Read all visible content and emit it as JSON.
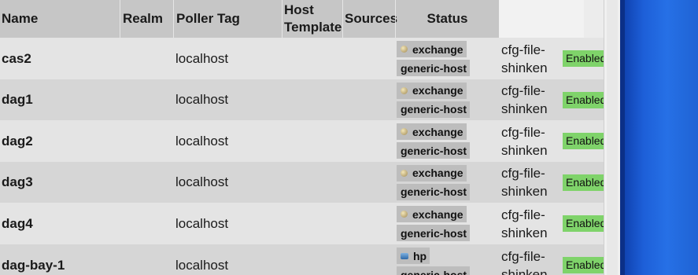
{
  "columns": {
    "name": "Name",
    "realm": "Realm",
    "poller_tag": "Poller Tag",
    "host_template": "Host Template",
    "sources": "Sources",
    "status": "Status"
  },
  "rows": [
    {
      "name": "cas2",
      "poller": "localhost",
      "tag1": "exchange",
      "tag1_icon": "exchange-icon",
      "tag2": "generic-host",
      "source_line1": "cfg-file-",
      "source_line2": "shinken",
      "status": "Enabled"
    },
    {
      "name": "dag1",
      "poller": "localhost",
      "tag1": "exchange",
      "tag1_icon": "exchange-icon",
      "tag2": "generic-host",
      "source_line1": "cfg-file-",
      "source_line2": "shinken",
      "status": "Enabled"
    },
    {
      "name": "dag2",
      "poller": "localhost",
      "tag1": "exchange",
      "tag1_icon": "exchange-icon",
      "tag2": "generic-host",
      "source_line1": "cfg-file-",
      "source_line2": "shinken",
      "status": "Enabled"
    },
    {
      "name": "dag3",
      "poller": "localhost",
      "tag1": "exchange",
      "tag1_icon": "exchange-icon",
      "tag2": "generic-host",
      "source_line1": "cfg-file-",
      "source_line2": "shinken",
      "status": "Enabled"
    },
    {
      "name": "dag4",
      "poller": "localhost",
      "tag1": "exchange",
      "tag1_icon": "exchange-icon",
      "tag2": "generic-host",
      "source_line1": "cfg-file-",
      "source_line2": "shinken",
      "status": "Enabled"
    },
    {
      "name": "dag-bay-1",
      "poller": "localhost",
      "tag1": "hp",
      "tag1_icon": "hp-icon",
      "tag2": "generic-host",
      "source_line1": "cfg-file-",
      "source_line2": "shinken",
      "status": "Enabled"
    }
  ],
  "colors": {
    "header_bg": "#c6c6c6",
    "row_light": "#e4e4e4",
    "row_dark": "#d6d6d6",
    "tag_bg": "#bdbdbd",
    "status_enabled": "#7fd36a",
    "desktop_blue": "#2670e6"
  }
}
